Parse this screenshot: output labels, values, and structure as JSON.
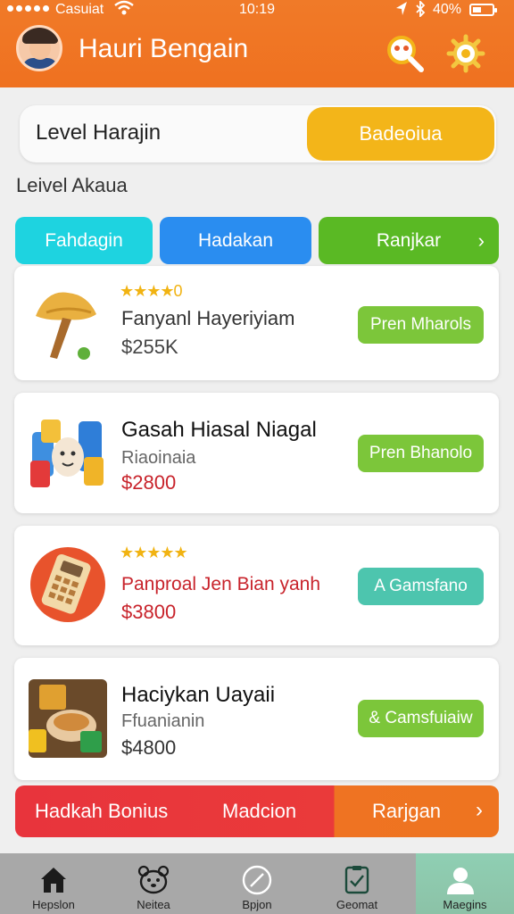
{
  "status_bar": {
    "carrier": "Casuiat",
    "time": "10:19",
    "battery": "40%"
  },
  "header": {
    "title": "Hauri Bengain"
  },
  "level": {
    "label": "Level Harajin",
    "button": "Badeoiua"
  },
  "section_title": "Leivel Akaua",
  "tabs": [
    {
      "label": "Fahdagin",
      "color": "#1ed3e0"
    },
    {
      "label": "Hadakan",
      "color": "#2a8df0"
    },
    {
      "label": "Ranjkar",
      "color": "#5ab924"
    }
  ],
  "products": [
    {
      "rating": "★★★★",
      "rating_num": "0",
      "name": "Fanyanl Hayeriyiam",
      "subtitle": "",
      "price": "$255K",
      "button": "Pren Mharols",
      "button_color": "#7cc63a"
    },
    {
      "rating": "",
      "rating_num": "",
      "name": "Gasah Hiasal Niagal",
      "subtitle": "Riaoinaia",
      "price": "$2800",
      "button": "Pren Bhanolo",
      "button_color": "#7cc63a"
    },
    {
      "rating": "★★★★★",
      "rating_num": "",
      "name": "Panproal Jen Bian yanh",
      "subtitle": "",
      "price": "$3800",
      "button": "A Gamsfano",
      "button_color": "#4dc5ae"
    },
    {
      "rating": "",
      "rating_num": "",
      "name": "Haciykan Uayaii",
      "subtitle": "Ffuanianin",
      "price": "$4800",
      "button": "& Camsfuiaiw",
      "button_color": "#7cc63a"
    }
  ],
  "banner": {
    "left": "Hadkah Bonius",
    "middle": "Madcion",
    "right": "Rarjgan"
  },
  "bottom_nav": [
    {
      "label": "Hepslon",
      "icon": "home-icon"
    },
    {
      "label": "Neitea",
      "icon": "bear-icon"
    },
    {
      "label": "Bpjon",
      "icon": "compass-icon"
    },
    {
      "label": "Geomat",
      "icon": "clipboard-icon"
    },
    {
      "label": "Maegins",
      "icon": "profile-icon",
      "active": true
    }
  ]
}
